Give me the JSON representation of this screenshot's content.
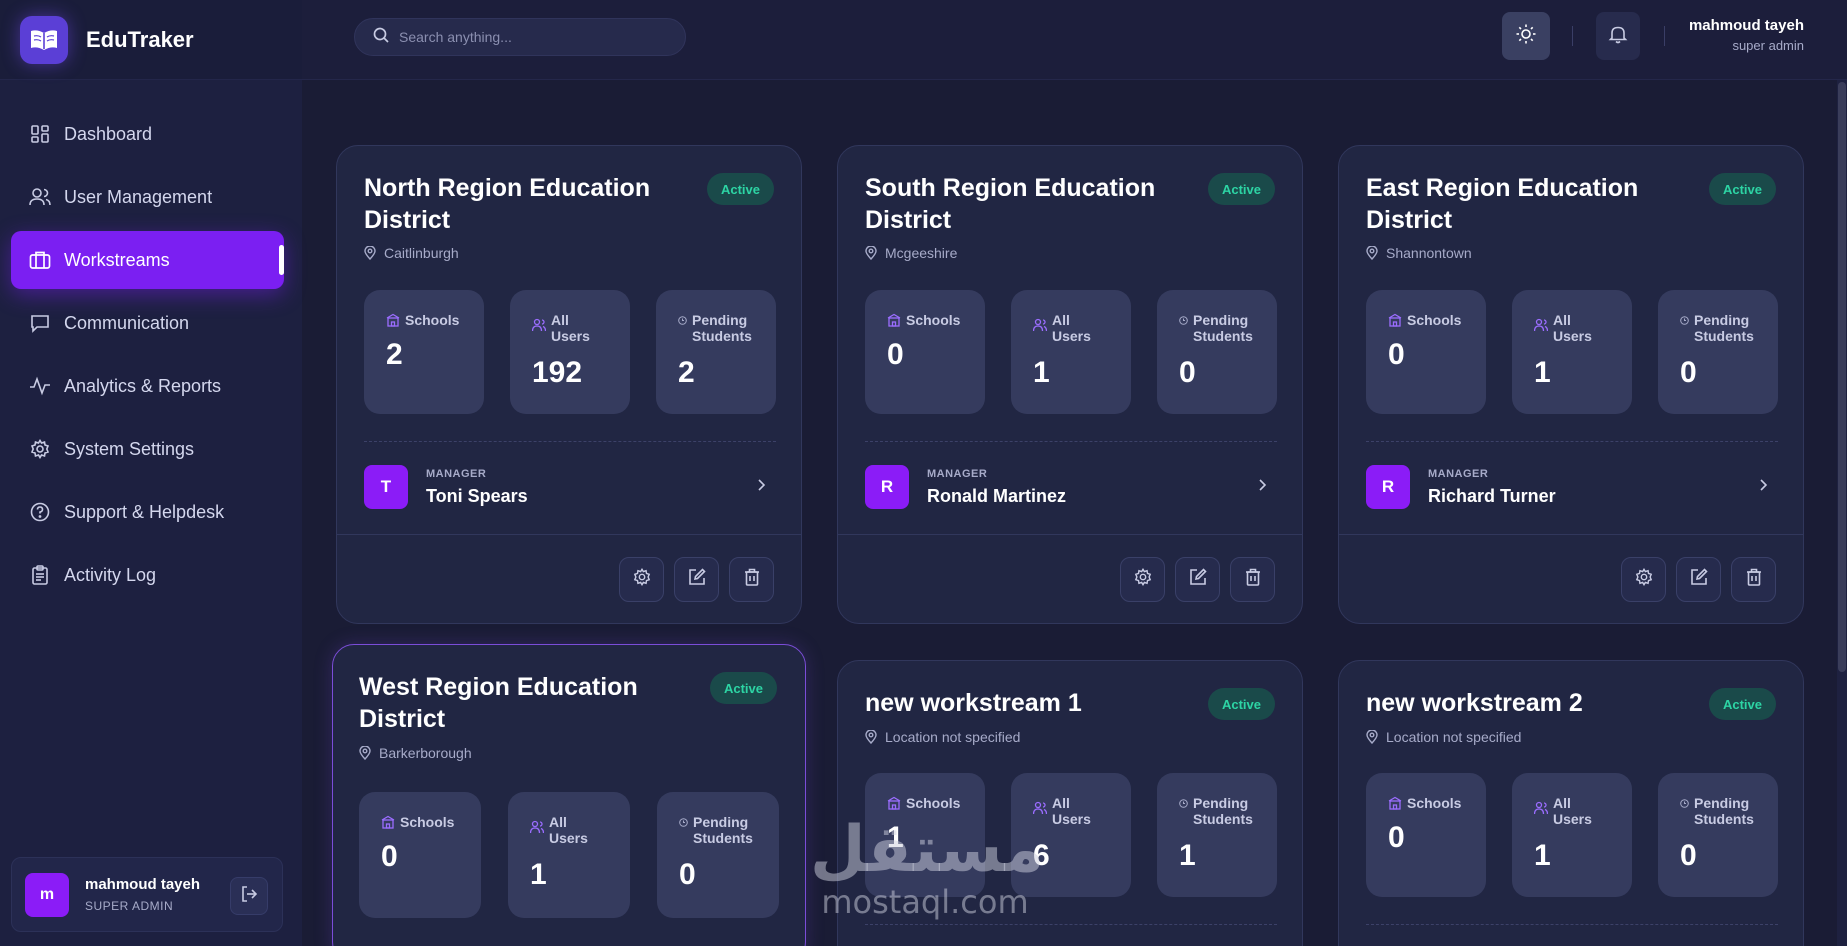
{
  "brand": {
    "name": "EduTraker"
  },
  "nav": [
    {
      "label": "Dashboard",
      "icon": "dashboard-icon"
    },
    {
      "label": "User Management",
      "icon": "users-icon"
    },
    {
      "label": "Workstreams",
      "icon": "briefcase-icon",
      "active": true
    },
    {
      "label": "Communication",
      "icon": "chat-icon"
    },
    {
      "label": "Analytics & Reports",
      "icon": "activity-icon"
    },
    {
      "label": "System Settings",
      "icon": "gear-icon"
    },
    {
      "label": "Support & Helpdesk",
      "icon": "help-icon"
    },
    {
      "label": "Activity Log",
      "icon": "clipboard-icon"
    }
  ],
  "sidebar_user": {
    "initial": "m",
    "name": "mahmoud tayeh",
    "role": "SUPER ADMIN"
  },
  "topbar": {
    "search_placeholder": "Search anything...",
    "user_name": "mahmoud tayeh",
    "user_role": "super admin"
  },
  "labels": {
    "schools": "Schools",
    "all": "All",
    "users": "Users",
    "pending": "Pending",
    "students": "Students",
    "manager": "MANAGER"
  },
  "cards": [
    {
      "title": "North Region Education District",
      "status": "Active",
      "location": "Caitlinburgh",
      "schools": "2",
      "users": "192",
      "pending": "2",
      "manager_initial": "T",
      "manager_name": "Toni Spears"
    },
    {
      "title": "South Region Education District",
      "status": "Active",
      "location": "Mcgeeshire",
      "schools": "0",
      "users": "1",
      "pending": "0",
      "manager_initial": "R",
      "manager_name": "Ronald Martinez"
    },
    {
      "title": "East Region Education District",
      "status": "Active",
      "location": "Shannontown",
      "schools": "0",
      "users": "1",
      "pending": "0",
      "manager_initial": "R",
      "manager_name": "Richard Turner"
    },
    {
      "title": "West Region Education District",
      "status": "Active",
      "location": "Barkerborough",
      "schools": "0",
      "users": "1",
      "pending": "0"
    },
    {
      "title": "new workstream 1",
      "status": "Active",
      "location": "Location not specified",
      "schools": "1",
      "users": "6",
      "pending": "1"
    },
    {
      "title": "new workstream 2",
      "status": "Active",
      "location": "Location not specified",
      "schools": "0",
      "users": "1",
      "pending": "0"
    }
  ],
  "watermark": {
    "arabic": "مستقل",
    "latin": "mostaql.com"
  },
  "colors": {
    "accent": "#7b1ff2",
    "active_badge": "#2dd4a4",
    "background": "#1a1c35"
  }
}
